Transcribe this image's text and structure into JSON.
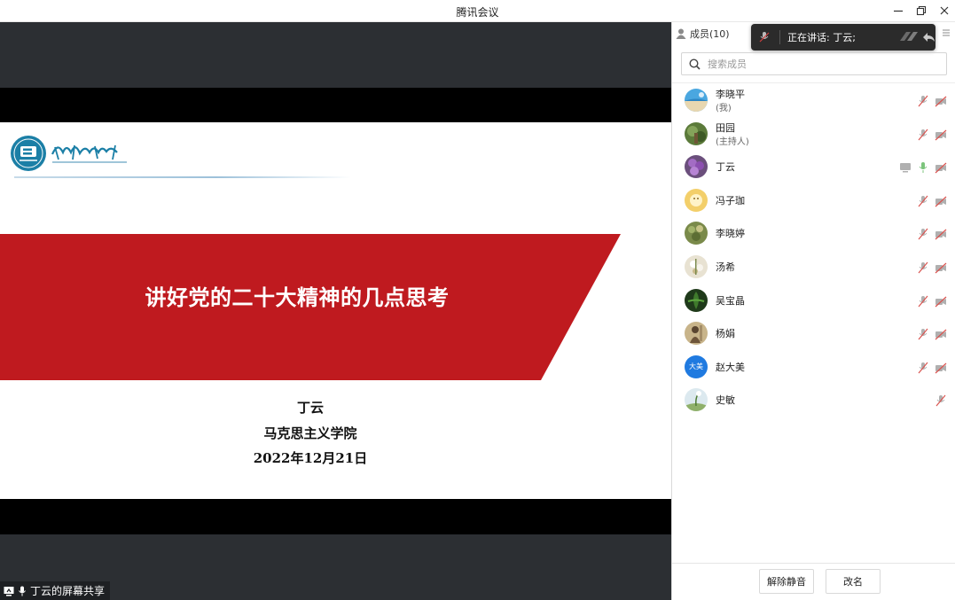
{
  "window": {
    "title": "腾讯会议"
  },
  "share": {
    "label": "丁云的屏幕共享",
    "slide": {
      "title": "讲好党的二十大精神的几点思考",
      "presenter": "丁云",
      "department": "马克思主义学院",
      "date": "2022年12月21日",
      "accent_color": "#bf1a1f"
    }
  },
  "panel": {
    "members_tab": "成员(10)",
    "speaking_indicator": "正在讲话: 丁云;",
    "search_placeholder": "搜索成员",
    "members": [
      {
        "name": "李晓平",
        "sub": "(我)"
      },
      {
        "name": "田园",
        "sub": "(主持人)"
      },
      {
        "name": "丁云",
        "sub": ""
      },
      {
        "name": "冯子珈",
        "sub": ""
      },
      {
        "name": "李晓婷",
        "sub": ""
      },
      {
        "name": "汤希",
        "sub": ""
      },
      {
        "name": "吴宝晶",
        "sub": ""
      },
      {
        "name": "杨娟",
        "sub": ""
      },
      {
        "name": "赵大美",
        "sub": "",
        "avatar_text": "大美"
      },
      {
        "name": "史敏",
        "sub": ""
      }
    ],
    "unmute_button": "解除静音",
    "rename_button": "改名"
  }
}
